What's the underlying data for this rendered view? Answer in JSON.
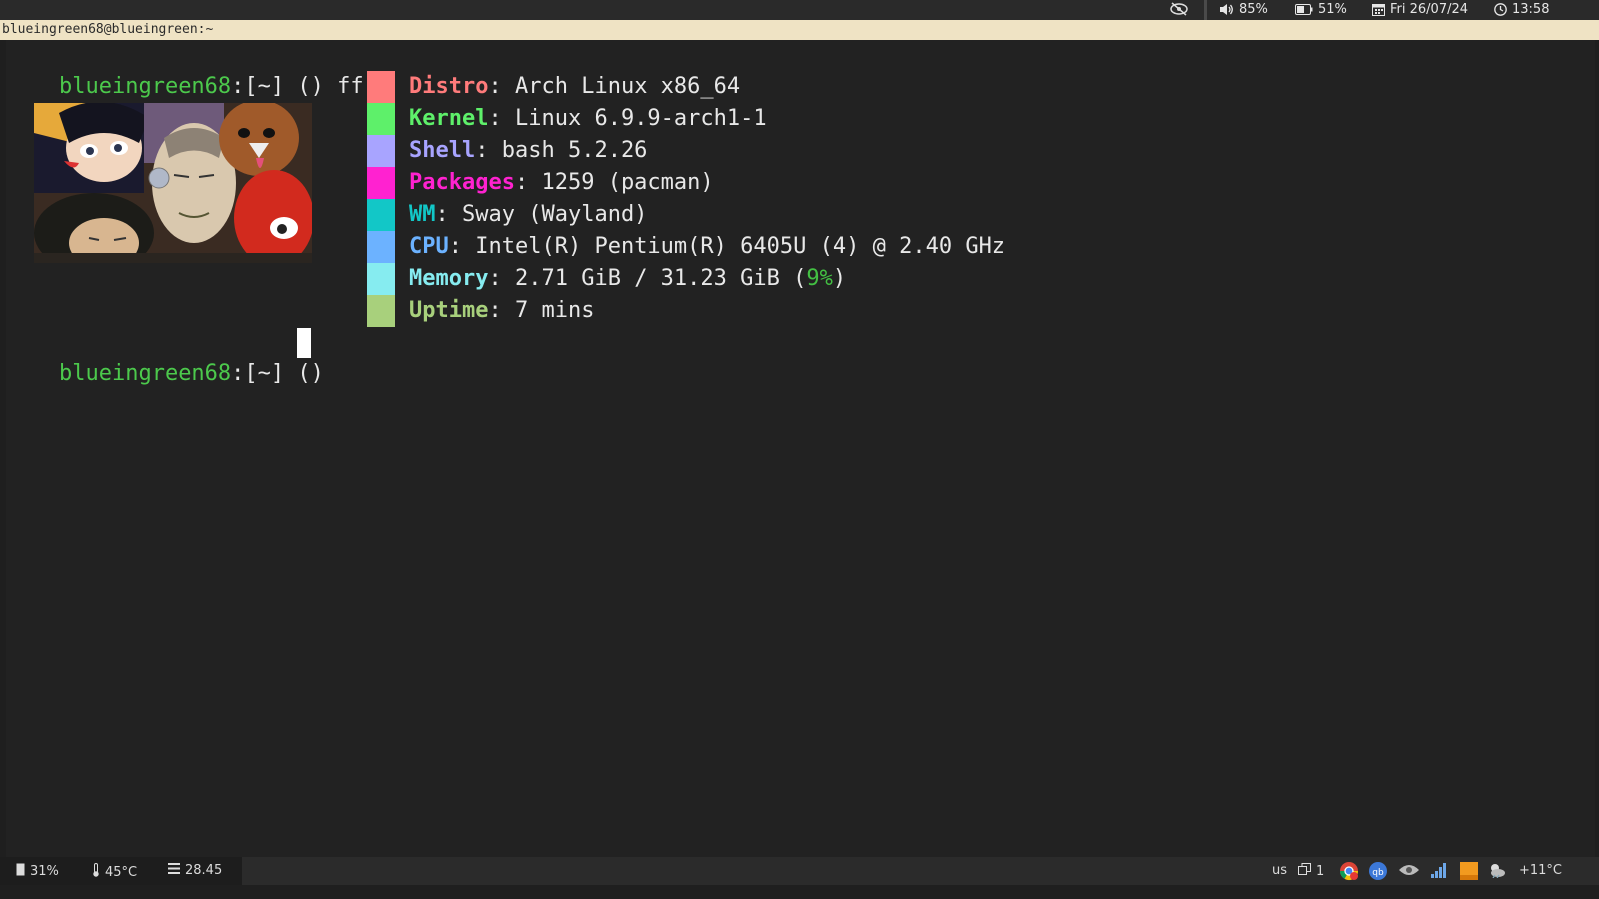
{
  "topbar": {
    "eye_icon": "eye-off-icon",
    "volume": "85%",
    "battery": "51%",
    "date": "Fri 26/07/24",
    "time": "13:58"
  },
  "window": {
    "title": "blueingreen68@blueingreen:~"
  },
  "terminal": {
    "prompt_user": "blueingreen68",
    "prompt_path": ":[~] ()",
    "command": "ff",
    "info": [
      {
        "key": "Distro",
        "sep": ": ",
        "value": "Arch Linux x86_64",
        "color": "#ff7b7b"
      },
      {
        "key": "Kernel",
        "sep": ": ",
        "value": "Linux 6.9.9-arch1-1",
        "color": "#5ef06a"
      },
      {
        "key": "Shell",
        "sep": ": ",
        "value": "bash 5.2.26",
        "color": "#a8a4ff"
      },
      {
        "key": "Packages",
        "sep": ": ",
        "value": "1259 (pacman)",
        "color": "#ff22d0"
      },
      {
        "key": "WM",
        "sep": ": ",
        "value": "Sway (Wayland)",
        "color": "#12c7c7"
      },
      {
        "key": "CPU",
        "sep": ": ",
        "value": "Intel(R) Pentium(R) 6405U (4) @ 2.40 GHz",
        "color": "#6cb2ff"
      },
      {
        "key": "Memory",
        "sep": ": ",
        "value": "2.71 GiB / 31.23 GiB (",
        "value_highlight": "9%",
        "value_end": ")",
        "color": "#86ecf0",
        "highlight_color": "#43c043"
      },
      {
        "key": "Uptime",
        "sep": ": ",
        "value": "7 mins",
        "color": "#a8d07c"
      }
    ]
  },
  "bottombar": {
    "cpu": "31%",
    "temp": "45°C",
    "load": "28.45",
    "layout": "us",
    "workspace": "1",
    "weather": "+11°C",
    "tray_icons": [
      "window-icon",
      "chrome-icon",
      "qbittorrent-icon",
      "eye-icon",
      "signal-icon",
      "orange-app-icon",
      "weather-icon"
    ]
  }
}
